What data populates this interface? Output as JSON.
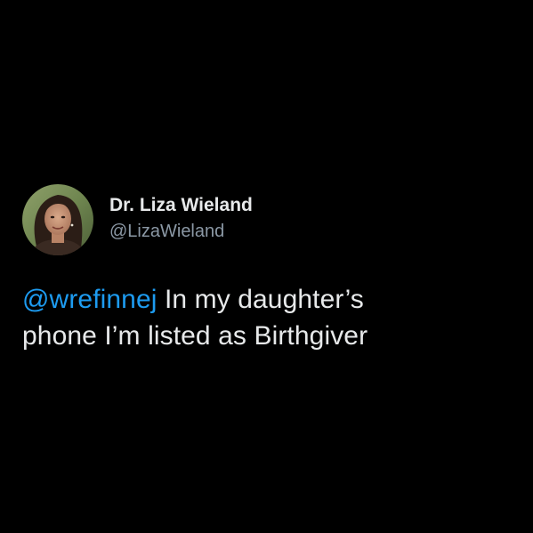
{
  "tweet": {
    "author": {
      "display_name": "Dr. Liza Wieland",
      "handle": "@LizaWieland",
      "avatar_icon": "profile-photo"
    },
    "body": {
      "mention": "@wrefinnej",
      "line1_rest": " In my daughter’s",
      "line2": "phone I’m listed as Birthgiver"
    }
  },
  "colors": {
    "background": "#000000",
    "text_primary": "#e7e9ea",
    "text_secondary": "#8b98a5",
    "link": "#1d9bf0"
  }
}
